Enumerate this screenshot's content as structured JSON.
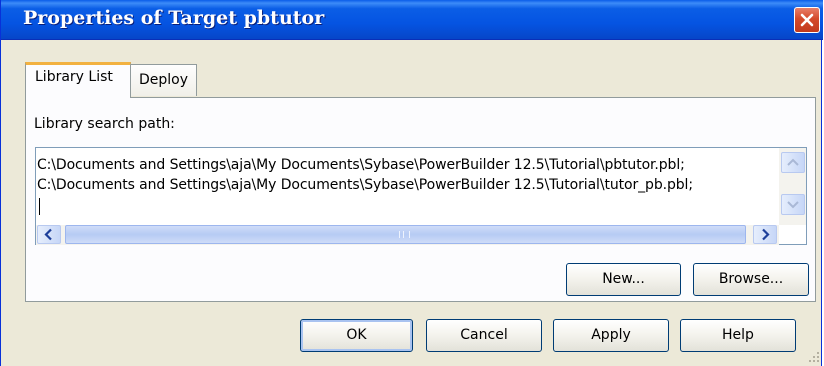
{
  "window": {
    "title": "Properties of Target pbtutor"
  },
  "tabs": [
    {
      "label": "Library List",
      "selected": true
    },
    {
      "label": "Deploy",
      "selected": false
    }
  ],
  "library": {
    "search_path_label": "Library search path:",
    "paths": [
      "C:\\Documents and Settings\\aja\\My Documents\\Sybase\\PowerBuilder 12.5\\Tutorial\\pbtutor.pbl;",
      "C:\\Documents and Settings\\aja\\My Documents\\Sybase\\PowerBuilder 12.5\\Tutorial\\tutor_pb.pbl;"
    ],
    "new_label": "New...",
    "browse_label": "Browse..."
  },
  "footer": {
    "ok_label": "OK",
    "cancel_label": "Cancel",
    "apply_label": "Apply",
    "help_label": "Help"
  },
  "colors": {
    "titlebar": "#0554e2",
    "dialog_face": "#ece9d8",
    "close_red": "#d44a2a",
    "tab_highlight": "#f2b140"
  },
  "icons": [
    "close-icon",
    "scroll-up-arrow-icon",
    "scroll-down-arrow-icon",
    "scroll-left-arrow-icon",
    "scroll-right-arrow-icon",
    "resize-grip-icon"
  ]
}
